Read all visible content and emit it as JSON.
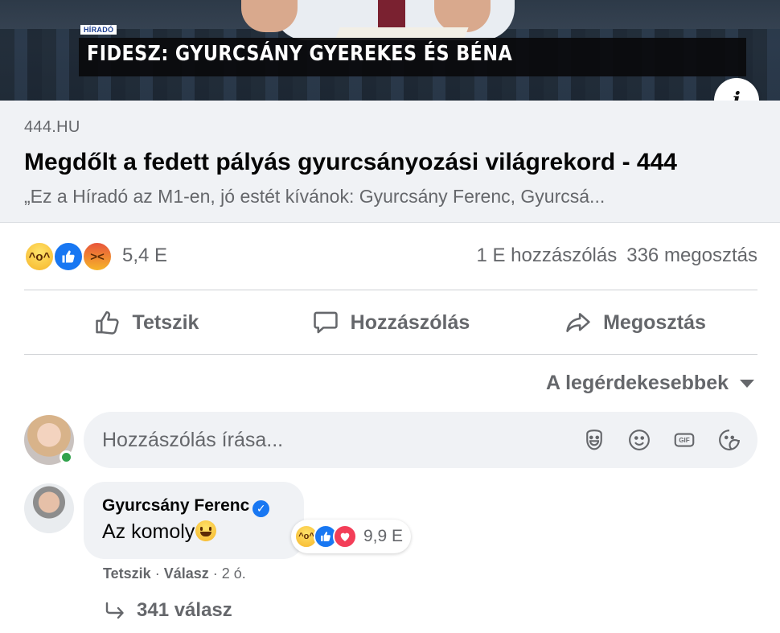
{
  "link_preview": {
    "image": {
      "source_tag": "HÍRADÓ",
      "headline": "FIDESZ: GYURCSÁNY GYEREKES ÉS BÉNA"
    },
    "info_icon": "info-icon",
    "domain": "444.HU",
    "title": "Megdőlt a fedett pályás gyurcsányozási világrekord - 444",
    "description": "„Ez a Híradó az M1-en, jó estét kívánok: Gyurcsány Ferenc, Gyurcsá..."
  },
  "reactions_summary": {
    "icons": [
      "haha-reaction-icon",
      "like-reaction-icon",
      "angry-reaction-icon"
    ],
    "count": "5,4 E",
    "comments": "1 E hozzászólás",
    "shares": "336 megosztás"
  },
  "actions": {
    "like": "Tetszik",
    "comment": "Hozzászólás",
    "share": "Megosztás"
  },
  "sort": {
    "label": "A legérdekesebbek"
  },
  "composer": {
    "placeholder": "Hozzászólás írása...",
    "tools": [
      "avatar-sticker-icon",
      "emoji-icon",
      "gif-icon",
      "sticker-icon"
    ]
  },
  "comment": {
    "author": "Gyurcsány Ferenc",
    "verified_icon": "verified-badge-icon",
    "text": "Az komoly",
    "reactions": {
      "icons": [
        "haha-reaction-icon",
        "like-reaction-icon",
        "love-reaction-icon"
      ],
      "count": "9,9 E"
    },
    "like_label": "Tetszik",
    "separator": " · ",
    "reply_label": "Válasz",
    "time": "2 ó.",
    "replies": "341 válasz"
  },
  "colors": {
    "accent": "#1877f2",
    "muted_text": "#65676b",
    "surface": "#f0f2f5",
    "online": "#31a24c"
  }
}
